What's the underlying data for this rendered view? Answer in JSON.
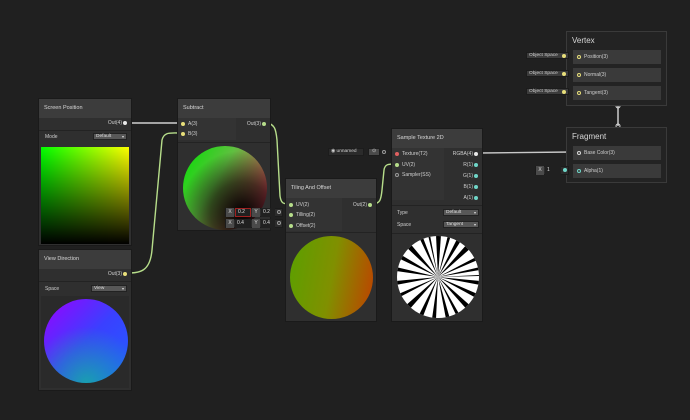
{
  "nodes": {
    "screen_position": {
      "title": "Screen Position",
      "out": "Out(4)",
      "mode_label": "Mode",
      "mode_value": "Default"
    },
    "view_direction": {
      "title": "View Direction",
      "out": "Out(3)",
      "space_label": "Space",
      "space_value": "View"
    },
    "subtract": {
      "title": "Subtract",
      "in_a": "A(3)",
      "in_b": "B(3)",
      "out": "Out(3)"
    },
    "tiling_offset": {
      "title": "Tiling And Offset",
      "in_uv": "UV(2)",
      "in_tiling": "Tilling(2)",
      "in_offset": "Offset(2)",
      "out": "Out(2)",
      "tiling_inputs": {
        "x_label": "X",
        "x_value": "0.2",
        "y_label": "Y",
        "y_value": "0.2"
      },
      "offset_inputs": {
        "x_label": "X",
        "x_value": "0.4",
        "y_label": "Y",
        "y_value": "0.4"
      }
    },
    "sample_texture": {
      "title": "Sample Texture 2D",
      "in_texture": "Texture(T2)",
      "in_uv": "UV(2)",
      "in_sampler": "Sampler(SS)",
      "out_rgba": "RGBA(4)",
      "out_r": "R(1)",
      "out_g": "G(1)",
      "out_b": "B(1)",
      "out_a": "A(1)",
      "type_label": "Type",
      "type_value": "Default",
      "space_label": "Space",
      "space_value": "Tangent",
      "texture_field": "unnamed"
    },
    "vertex": {
      "title": "Vertex",
      "slots": [
        "Position(3)",
        "Normal(3)",
        "Tangent(3)"
      ],
      "space_chips": [
        "Object Space",
        "Object Space",
        "Object Space"
      ]
    },
    "fragment": {
      "title": "Fragment",
      "slots": [
        "Base Color(3)",
        "Alpha(1)"
      ],
      "alpha_x_label": "X",
      "alpha_value": "1"
    }
  },
  "colors": {
    "background": "#202020",
    "node": "#2f2f2f",
    "wire_vector": "#b6dd8a",
    "wire_color": "#c8c8c8",
    "port_vector3": "#e8df7a",
    "port_vector2": "#b6dd8a",
    "port_vector1": "#6fd6c8",
    "port_texture": "#e06060"
  }
}
